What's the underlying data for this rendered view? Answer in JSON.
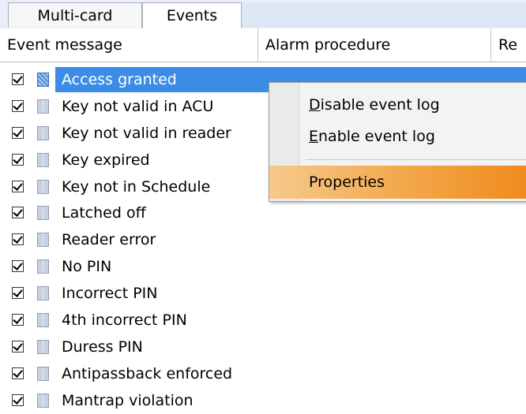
{
  "tabs": [
    {
      "label": "Multi-card"
    },
    {
      "label": "Events"
    }
  ],
  "columns": [
    "Event message",
    "Alarm procedure",
    "Re"
  ],
  "events": [
    {
      "label": "Access granted",
      "checked": true,
      "selected": true
    },
    {
      "label": "Key not valid in ACU",
      "checked": true
    },
    {
      "label": "Key not valid in reader",
      "checked": true
    },
    {
      "label": "Key expired",
      "checked": true
    },
    {
      "label": "Key not in Schedule",
      "checked": true
    },
    {
      "label": "Latched off",
      "checked": true
    },
    {
      "label": "Reader error",
      "checked": true
    },
    {
      "label": "No PIN",
      "checked": true
    },
    {
      "label": "Incorrect PIN",
      "checked": true
    },
    {
      "label": "4th incorrect PIN",
      "checked": true
    },
    {
      "label": "Duress PIN",
      "checked": true
    },
    {
      "label": "Antipassback enforced",
      "checked": true
    },
    {
      "label": "Mantrap violation",
      "checked": true
    }
  ],
  "context_menu": {
    "disable_first": "D",
    "disable_rest": "isable event log",
    "enable_first": "E",
    "enable_rest": "nable event log",
    "properties": "Properties"
  },
  "colors": {
    "selection": "#3c8ce6",
    "menu_highlight": "#f08a1c"
  }
}
